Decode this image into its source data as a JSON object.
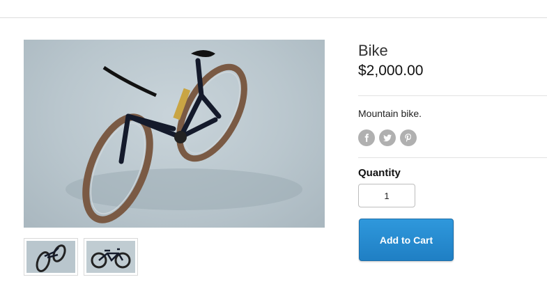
{
  "product": {
    "title": "Bike",
    "price": "$2,000.00",
    "description": "Mountain bike."
  },
  "social": [
    {
      "icon": "facebook-icon"
    },
    {
      "icon": "twitter-icon"
    },
    {
      "icon": "pinterest-icon"
    }
  ],
  "quantity": {
    "label": "Quantity",
    "value": "1"
  },
  "cart": {
    "button_label": "Add to Cart"
  },
  "images": {
    "main_alt": "Mountain bike photo",
    "thumbnails": [
      "thumbnail-1",
      "thumbnail-2"
    ]
  },
  "colors": {
    "button": "#1f7fc4",
    "social_icon_bg": "#b0b0b0"
  }
}
